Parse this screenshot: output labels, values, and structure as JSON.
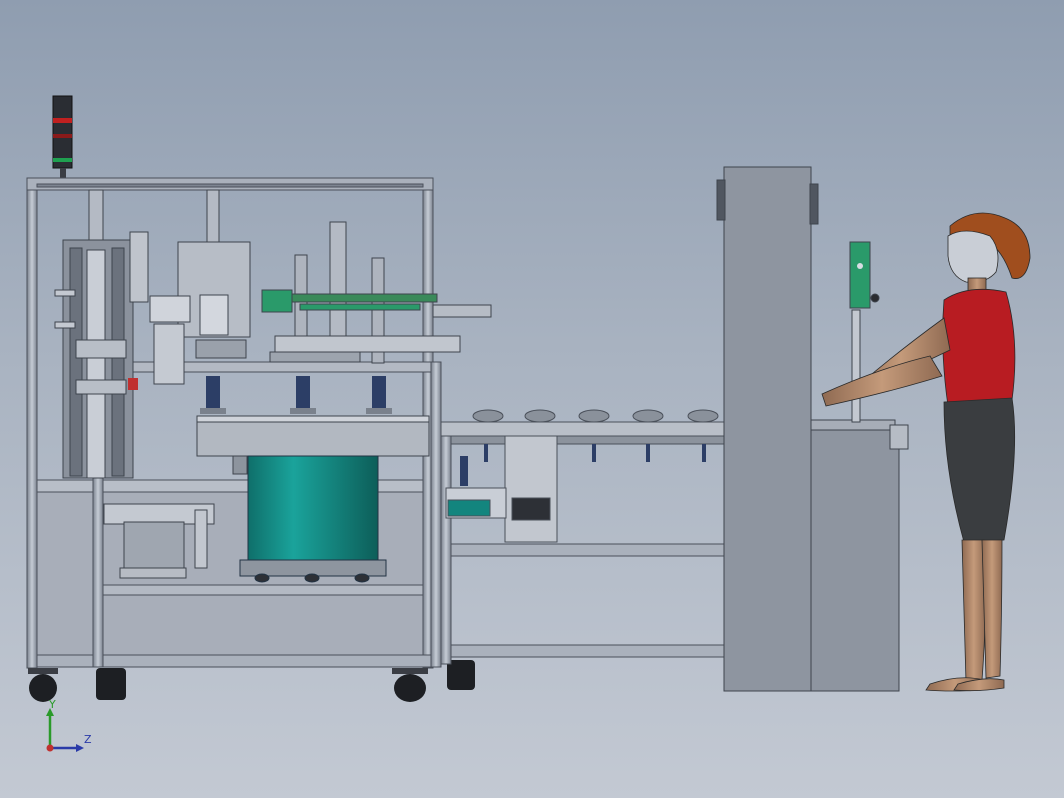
{
  "viewport": {
    "background_top": "#8f9db0",
    "background_bottom": "#c3c9d3"
  },
  "triad": {
    "y_label": "Y",
    "z_label": "Z",
    "y_color": "#2a9a2a",
    "z_color": "#2a3aa8",
    "origin_color": "#c03030"
  },
  "colors": {
    "frame": "#9aa3b0",
    "frame_edge": "#4a505a",
    "panel": "#a7adb8",
    "teal_drum": "#13857e",
    "stack_light_red": "#c02020",
    "stack_light_green": "#1fa050",
    "hmi_green": "#2a9a6a",
    "shirt": "#b81c22",
    "shorts": "#3a3d40",
    "hair": "#a04e1e",
    "skin": "#b58a6a"
  }
}
